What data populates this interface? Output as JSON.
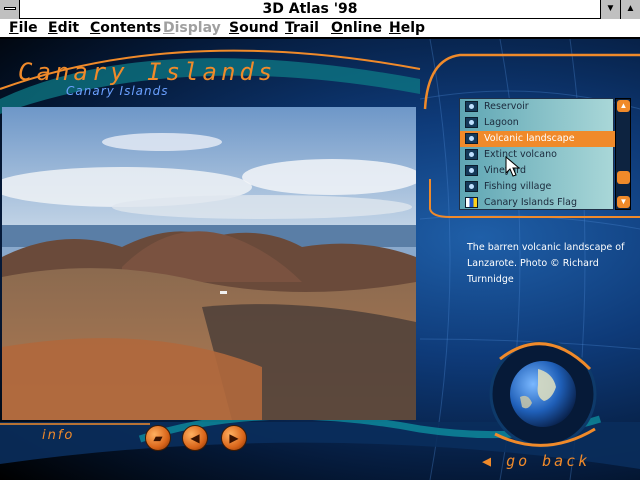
{
  "window": {
    "title": "3D Atlas '98",
    "minimize_glyph": "▼",
    "maximize_glyph": "▲"
  },
  "menu": [
    {
      "label": "File",
      "underline": "F",
      "rest": "ile",
      "enabled": true
    },
    {
      "label": "Edit",
      "underline": "E",
      "rest": "dit",
      "enabled": true
    },
    {
      "label": "Contents",
      "underline": "C",
      "rest": "ontents",
      "enabled": true
    },
    {
      "label": "Display",
      "underline": "D",
      "rest": "isplay",
      "enabled": false
    },
    {
      "label": "Sound",
      "underline": "S",
      "rest": "ound",
      "enabled": true
    },
    {
      "label": "Trail",
      "underline": "T",
      "rest": "rail",
      "enabled": true
    },
    {
      "label": "Online",
      "underline": "O",
      "rest": "nline",
      "enabled": true
    },
    {
      "label": "Help",
      "underline": "H",
      "rest": "elp",
      "enabled": true
    }
  ],
  "place": {
    "title": "Canary Islands",
    "subtitle": "Canary Islands"
  },
  "photo_list": {
    "items": [
      {
        "label": "Reservoir",
        "icon": "camera-icon"
      },
      {
        "label": "Lagoon",
        "icon": "camera-icon"
      },
      {
        "label": "Volcanic landscape",
        "icon": "camera-icon",
        "selected": true
      },
      {
        "label": "Extinct volcano",
        "icon": "camera-icon"
      },
      {
        "label": "Vineyard",
        "icon": "camera-icon"
      },
      {
        "label": "Fishing village",
        "icon": "camera-icon"
      },
      {
        "label": "Canary Islands Flag",
        "icon": "flag-icon"
      }
    ],
    "scroll_up_glyph": "▲",
    "scroll_down_glyph": "▼"
  },
  "caption": "The barren volcanic landscape of Lanzarote. Photo © Richard Turnnidge",
  "bottom": {
    "info_label": "info",
    "go_back_label": "go back",
    "folder_glyph": "▰",
    "back_glyph": "◀",
    "forward_glyph": "▶",
    "go_back_arrow": "◀"
  },
  "colors": {
    "accent_orange": "#f08a2a",
    "accent_blue": "#6aa0ff",
    "list_selected": "#f08a2a"
  }
}
